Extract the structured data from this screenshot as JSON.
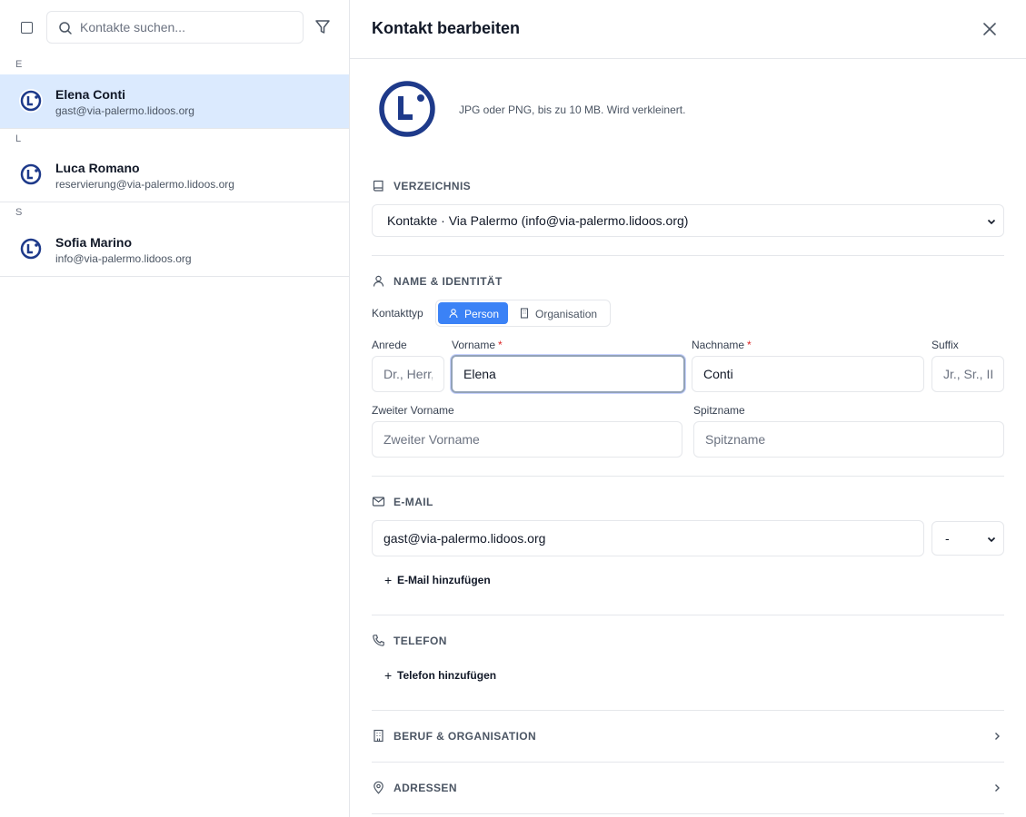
{
  "sidebar": {
    "search_placeholder": "Kontakte suchen...",
    "groups": [
      {
        "letter": "E",
        "contacts": [
          {
            "name": "Elena Conti",
            "email": "gast@via-palermo.lidoos.org",
            "active": true
          }
        ]
      },
      {
        "letter": "L",
        "contacts": [
          {
            "name": "Luca Romano",
            "email": "reservierung@via-palermo.lidoos.org",
            "active": false
          }
        ]
      },
      {
        "letter": "S",
        "contacts": [
          {
            "name": "Sofia Marino",
            "email": "info@via-palermo.lidoos.org",
            "active": false
          }
        ]
      }
    ]
  },
  "editor": {
    "title": "Kontakt bearbeiten",
    "photo_hint": "JPG oder PNG, bis zu 10 MB. Wird verkleinert.",
    "directory": {
      "section_title": "VERZEICHNIS",
      "selected": "Kontakte · Via Palermo (info@via-palermo.lidoos.org)"
    },
    "identity": {
      "section_title": "NAME & IDENTITÄT",
      "type_label": "Kontakttyp",
      "type_person": "Person",
      "type_org": "Organisation",
      "anrede_label": "Anrede",
      "anrede_placeholder": "Dr., Herr,",
      "vorname_label": "Vorname",
      "vorname_value": "Elena",
      "nachname_label": "Nachname",
      "nachname_value": "Conti",
      "suffix_label": "Suffix",
      "suffix_placeholder": "Jr., Sr., III",
      "zweiter_label": "Zweiter Vorname",
      "zweiter_placeholder": "Zweiter Vorname",
      "spitzname_label": "Spitzname",
      "spitzname_placeholder": "Spitzname",
      "required_mark": "*"
    },
    "email": {
      "section_title": "E-MAIL",
      "value": "gast@via-palermo.lidoos.org",
      "type_selected": "-",
      "add_label": "E-Mail hinzufügen"
    },
    "phone": {
      "section_title": "TELEFON",
      "add_label": "Telefon hinzufügen"
    },
    "job": {
      "section_title": "BERUF & ORGANISATION"
    },
    "addresses": {
      "section_title": "ADRESSEN"
    },
    "plus": "+"
  },
  "colors": {
    "accent": "#3b82f6",
    "active_row": "#dbeafe",
    "logo": "#1e3a8a"
  },
  "icons": [
    "search-icon",
    "filter-icon",
    "close-icon",
    "book-icon",
    "user-icon",
    "building-icon",
    "mail-icon",
    "phone-icon",
    "map-pin-icon",
    "chevron-down-icon",
    "chevron-right-icon"
  ]
}
